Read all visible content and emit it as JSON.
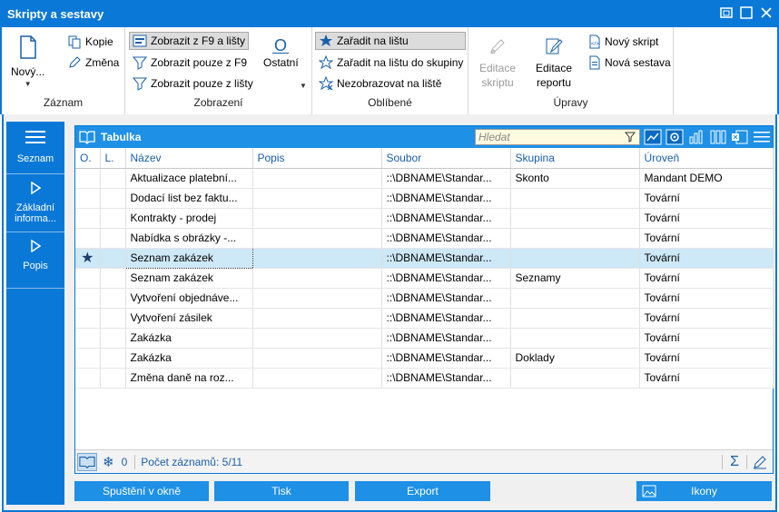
{
  "window": {
    "title": "Skripty a sestavy"
  },
  "ribbon": {
    "zaznam": {
      "label": "Záznam",
      "novy": "Nový...",
      "kopie": "Kopie",
      "zmena": "Změna"
    },
    "zobrazeni": {
      "label": "Zobrazení",
      "f9_a_listy": "Zobrazit z F9 a lišty",
      "pouze_f9": "Zobrazit pouze z F9",
      "pouze_listy": "Zobrazit pouze z lišty",
      "ostatni": "Ostatní"
    },
    "oblibene": {
      "label": "Oblíbené",
      "zaradit": "Zařadit na lištu",
      "zaradit_skupiny": "Zařadit na lištu do skupiny",
      "nezobrazovat": "Nezobrazovat na liště"
    },
    "upravy": {
      "label": "Úpravy",
      "editace_skriptu_1": "Editace",
      "editace_skriptu_2": "skriptu",
      "editace_reportu_1": "Editace",
      "editace_reportu_2": "reportu",
      "novy_skript": "Nový skript",
      "nova_sestava": "Nová sestava"
    }
  },
  "nav": {
    "seznam": "Seznam",
    "zakladni_1": "Základní",
    "zakladni_2": "informa...",
    "popis": "Popis"
  },
  "panel": {
    "title": "Tabulka",
    "search_placeholder": "Hledat"
  },
  "table": {
    "columns": [
      "O.",
      "L.",
      "Název",
      "Popis",
      "Soubor",
      "Skupina",
      "Úroveň"
    ],
    "rows": [
      {
        "o": "",
        "l": "",
        "nazev": "Aktualizace platební...",
        "popis": "",
        "soubor": "::\\DBNAME\\Standar...",
        "skupina": "Skonto",
        "uroven": "Mandant DEMO"
      },
      {
        "o": "",
        "l": "",
        "nazev": "Dodací list bez faktu...",
        "popis": "",
        "soubor": "::\\DBNAME\\Standar...",
        "skupina": "",
        "uroven": "Tovární"
      },
      {
        "o": "",
        "l": "",
        "nazev": "Kontrakty - prodej",
        "popis": "",
        "soubor": "::\\DBNAME\\Standar...",
        "skupina": "",
        "uroven": "Tovární"
      },
      {
        "o": "",
        "l": "",
        "nazev": "Nabídka s obrázky -...",
        "popis": "",
        "soubor": "::\\DBNAME\\Standar...",
        "skupina": "",
        "uroven": "Tovární"
      },
      {
        "o": "★",
        "l": "",
        "nazev": "Seznam zakázek",
        "popis": "",
        "soubor": "::\\DBNAME\\Standar...",
        "skupina": "",
        "uroven": "Tovární",
        "selected": true
      },
      {
        "o": "",
        "l": "",
        "nazev": "Seznam zakázek",
        "popis": "",
        "soubor": "::\\DBNAME\\Standar...",
        "skupina": "Seznamy",
        "uroven": "Tovární"
      },
      {
        "o": "",
        "l": "",
        "nazev": "Vytvoření objednáve...",
        "popis": "",
        "soubor": "::\\DBNAME\\Standar...",
        "skupina": "",
        "uroven": "Tovární"
      },
      {
        "o": "",
        "l": "",
        "nazev": "Vytvoření zásilek",
        "popis": "",
        "soubor": "::\\DBNAME\\Standar...",
        "skupina": "",
        "uroven": "Tovární"
      },
      {
        "o": "",
        "l": "",
        "nazev": "Zakázka",
        "popis": "",
        "soubor": "::\\DBNAME\\Standar...",
        "skupina": "",
        "uroven": "Tovární"
      },
      {
        "o": "",
        "l": "",
        "nazev": "Zakázka",
        "popis": "",
        "soubor": "::\\DBNAME\\Standar...",
        "skupina": "Doklady",
        "uroven": "Tovární"
      },
      {
        "o": "",
        "l": "",
        "nazev": "Změna daně na roz...",
        "popis": "",
        "soubor": "::\\DBNAME\\Standar...",
        "skupina": "",
        "uroven": "Tovární"
      }
    ]
  },
  "footer": {
    "zero": "0",
    "count": "Počet záznamů: 5/11"
  },
  "buttons": {
    "spusteni": "Spuštění v okně",
    "tisk": "Tisk",
    "export": "Export",
    "ikony": "Ikony"
  },
  "colors": {
    "accent": "#0a78d7",
    "header": "#1e90e6",
    "selected_row": "#cde8f6",
    "search_bg": "#fffbe0"
  }
}
